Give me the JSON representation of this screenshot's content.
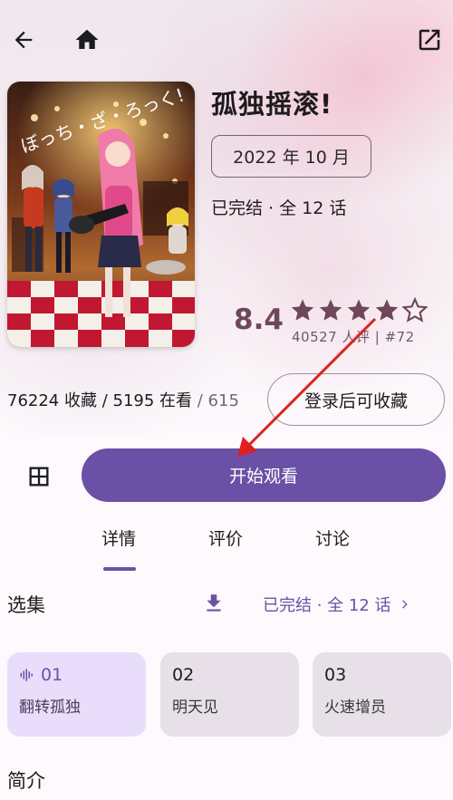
{
  "header": {
    "back_icon": "arrow-left-icon",
    "home_icon": "home-icon",
    "share_icon": "open-external-icon"
  },
  "subject": {
    "title": "孤独摇滚!",
    "air_date": "2022 年 10 月",
    "status": "已完结 · 全 12 话",
    "cover_text": "ぼっち・ざ・ろっく!"
  },
  "rating": {
    "score": "8.4",
    "stars_filled": 4,
    "stars_total": 5,
    "meta": "40527 人评 | #72"
  },
  "collection": {
    "stats": "76224 收藏 / 5195 在看",
    "total": " / 615",
    "login_button": "登录后可收藏"
  },
  "actions": {
    "grid_icon": "grid-view-icon",
    "watch_button": "开始观看"
  },
  "tabs": [
    {
      "label": "详情"
    },
    {
      "label": "评价"
    },
    {
      "label": "讨论"
    }
  ],
  "episodes_section": {
    "title": "选集",
    "download_icon": "download-icon",
    "link": "已完结 · 全 12 话",
    "items": [
      {
        "num": "01",
        "name": "翻转孤独"
      },
      {
        "num": "02",
        "name": "明天见"
      },
      {
        "num": "03",
        "name": "火速增员"
      }
    ]
  },
  "intro_section": {
    "title": "简介"
  },
  "colors": {
    "accent": "#6a51a6",
    "annotation": "#e02020"
  }
}
